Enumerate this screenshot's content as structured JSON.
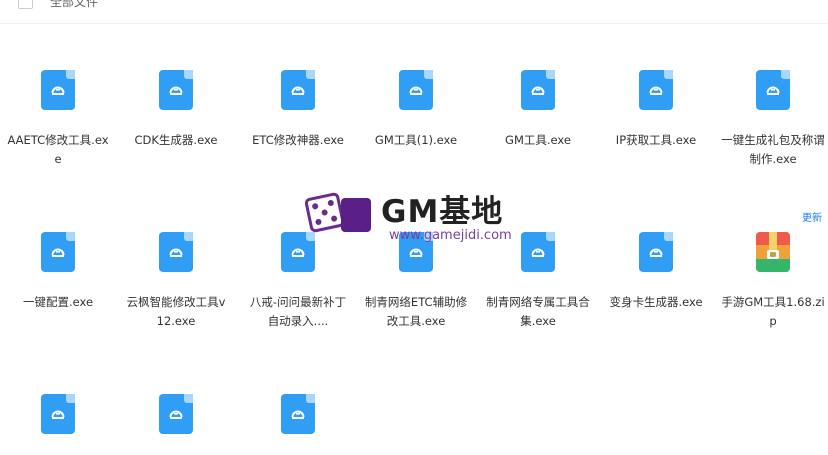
{
  "header": {
    "title": "全部文件"
  },
  "files": [
    {
      "name": "AAETC修改工具.exe",
      "type": "exe"
    },
    {
      "name": "CDK生成器.exe",
      "type": "exe"
    },
    {
      "name": "ETC修改神器.exe",
      "type": "exe"
    },
    {
      "name": "GM工具(1).exe",
      "type": "exe"
    },
    {
      "name": "GM工具.exe",
      "type": "exe"
    },
    {
      "name": "IP获取工具.exe",
      "type": "exe"
    },
    {
      "name": "一键生成礼包及称谓制作.exe",
      "type": "exe"
    },
    {
      "name": "一键配置.exe",
      "type": "exe"
    },
    {
      "name": "云枫智能修改工具v12.exe",
      "type": "exe"
    },
    {
      "name": "八戒-问问最新补丁自动录入....",
      "type": "exe"
    },
    {
      "name": "制青网络ETC辅助修改工具.exe",
      "type": "exe"
    },
    {
      "name": "制青网络专属工具合集.exe",
      "type": "exe"
    },
    {
      "name": "变身卡生成器.exe",
      "type": "exe"
    },
    {
      "name": "手游GM工具1.68.zip",
      "type": "zip"
    },
    {
      "name": "",
      "type": "exe"
    },
    {
      "name": "",
      "type": "exe"
    },
    {
      "name": "",
      "type": "exe"
    }
  ],
  "watermark": {
    "brand": "GM基地",
    "url": "www.gamejidi.com"
  },
  "update_tag": "更新",
  "colors": {
    "exe_icon": "#2f9ef4",
    "exe_fold": "#a9d6fb",
    "accent": "#1a7de8"
  }
}
